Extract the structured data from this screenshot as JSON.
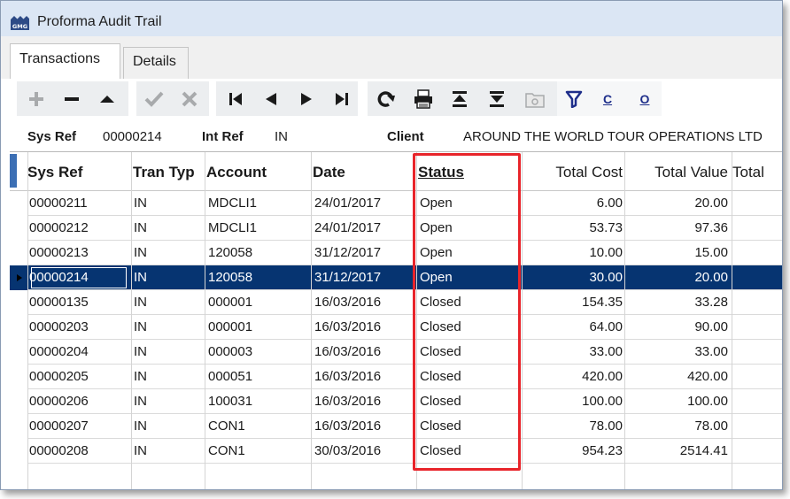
{
  "window": {
    "title": "Proforma Audit Trail",
    "icon": "app-logo-icon"
  },
  "tabs": [
    {
      "label": "Transactions",
      "active": true
    },
    {
      "label": "Details",
      "active": false
    }
  ],
  "toolbar": {
    "buttons": [
      {
        "name": "add-icon",
        "enabled": false
      },
      {
        "name": "remove-icon",
        "enabled": true
      },
      {
        "name": "eject-icon",
        "enabled": true
      },
      {
        "name": "confirm-icon",
        "enabled": false
      },
      {
        "name": "cancel-icon",
        "enabled": false
      },
      {
        "name": "first-record-icon",
        "enabled": true
      },
      {
        "name": "previous-record-icon",
        "enabled": true
      },
      {
        "name": "next-record-icon",
        "enabled": true
      },
      {
        "name": "last-record-icon",
        "enabled": true
      },
      {
        "name": "refresh-icon",
        "enabled": true
      },
      {
        "name": "print-icon",
        "enabled": true
      },
      {
        "name": "sort-ascending-icon",
        "enabled": true
      },
      {
        "name": "sort-descending-icon",
        "enabled": true
      },
      {
        "name": "folder-icon",
        "enabled": false
      },
      {
        "name": "filter-icon",
        "enabled": true
      }
    ],
    "text_buttons": [
      "C",
      "O"
    ],
    "accent_color": "#1e2e8a"
  },
  "record_info": {
    "sys_ref_label": "Sys Ref",
    "sys_ref_value": "00000214",
    "int_ref_label": "Int Ref",
    "int_ref_value": "IN",
    "client_label": "Client",
    "client_value": "AROUND THE WORLD TOUR OPERATIONS LTD"
  },
  "grid": {
    "columns": [
      "Sys Ref",
      "Tran Typ",
      "Account",
      "Date",
      "Status",
      "Total Cost",
      "Total Value",
      "Total"
    ],
    "rows": [
      {
        "sys_ref": "00000211",
        "tran_type": "IN",
        "account": "MDCLI1",
        "date": "24/01/2017",
        "status": "Open",
        "total_cost": "6.00",
        "total_value": "20.00"
      },
      {
        "sys_ref": "00000212",
        "tran_type": "IN",
        "account": "MDCLI1",
        "date": "24/01/2017",
        "status": "Open",
        "total_cost": "53.73",
        "total_value": "97.36"
      },
      {
        "sys_ref": "00000213",
        "tran_type": "IN",
        "account": "120058",
        "date": "31/12/2017",
        "status": "Open",
        "total_cost": "10.00",
        "total_value": "15.00"
      },
      {
        "sys_ref": "00000214",
        "tran_type": "IN",
        "account": "120058",
        "date": "31/12/2017",
        "status": "Open",
        "total_cost": "30.00",
        "total_value": "20.00"
      },
      {
        "sys_ref": "00000135",
        "tran_type": "IN",
        "account": "000001",
        "date": "16/03/2016",
        "status": "Closed",
        "total_cost": "154.35",
        "total_value": "33.28"
      },
      {
        "sys_ref": "00000203",
        "tran_type": "IN",
        "account": "000001",
        "date": "16/03/2016",
        "status": "Closed",
        "total_cost": "64.00",
        "total_value": "90.00"
      },
      {
        "sys_ref": "00000204",
        "tran_type": "IN",
        "account": "000003",
        "date": "16/03/2016",
        "status": "Closed",
        "total_cost": "33.00",
        "total_value": "33.00"
      },
      {
        "sys_ref": "00000205",
        "tran_type": "IN",
        "account": "000051",
        "date": "16/03/2016",
        "status": "Closed",
        "total_cost": "420.00",
        "total_value": "420.00"
      },
      {
        "sys_ref": "00000206",
        "tran_type": "IN",
        "account": "100031",
        "date": "16/03/2016",
        "status": "Closed",
        "total_cost": "100.00",
        "total_value": "100.00"
      },
      {
        "sys_ref": "00000207",
        "tran_type": "IN",
        "account": "CON1",
        "date": "16/03/2016",
        "status": "Closed",
        "total_cost": "78.00",
        "total_value": "78.00"
      },
      {
        "sys_ref": "00000208",
        "tran_type": "IN",
        "account": "CON1",
        "date": "30/03/2016",
        "status": "Closed",
        "total_cost": "954.23",
        "total_value": "2514.41"
      }
    ],
    "selected_row": 3,
    "selection_color": "#063471",
    "highlight_color": "#e8242a"
  }
}
